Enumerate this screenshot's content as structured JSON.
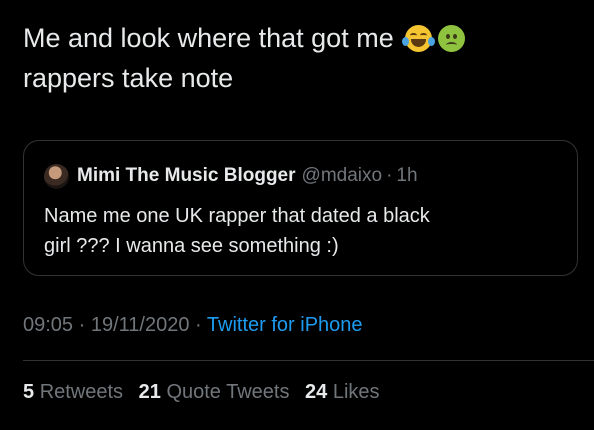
{
  "tweet": {
    "text_line1": "Me and look where that got me",
    "text_line2": "rappers take note",
    "emojis": [
      "face-with-tears-of-joy-icon",
      "nauseated-face-icon"
    ]
  },
  "quoted_tweet": {
    "display_name": "Mimi The Music Blogger",
    "handle": "@mdaixo",
    "separator": "·",
    "time": "1h",
    "text_line1": "Name me one UK rapper that dated a black",
    "text_line2": "girl ??? I wanna see something :)"
  },
  "meta": {
    "time": "09:05",
    "sep1": "·",
    "date": "19/11/2020",
    "sep2": "·",
    "source": "Twitter for iPhone"
  },
  "stats": {
    "retweets_count": "5",
    "retweets_label": "Retweets",
    "quotes_count": "21",
    "quotes_label": "Quote Tweets",
    "likes_count": "24",
    "likes_label": "Likes"
  },
  "colors": {
    "background": "#000000",
    "text": "#e7e9ea",
    "secondary": "#71767b",
    "link": "#1d9bf0",
    "border": "#2f3336"
  }
}
